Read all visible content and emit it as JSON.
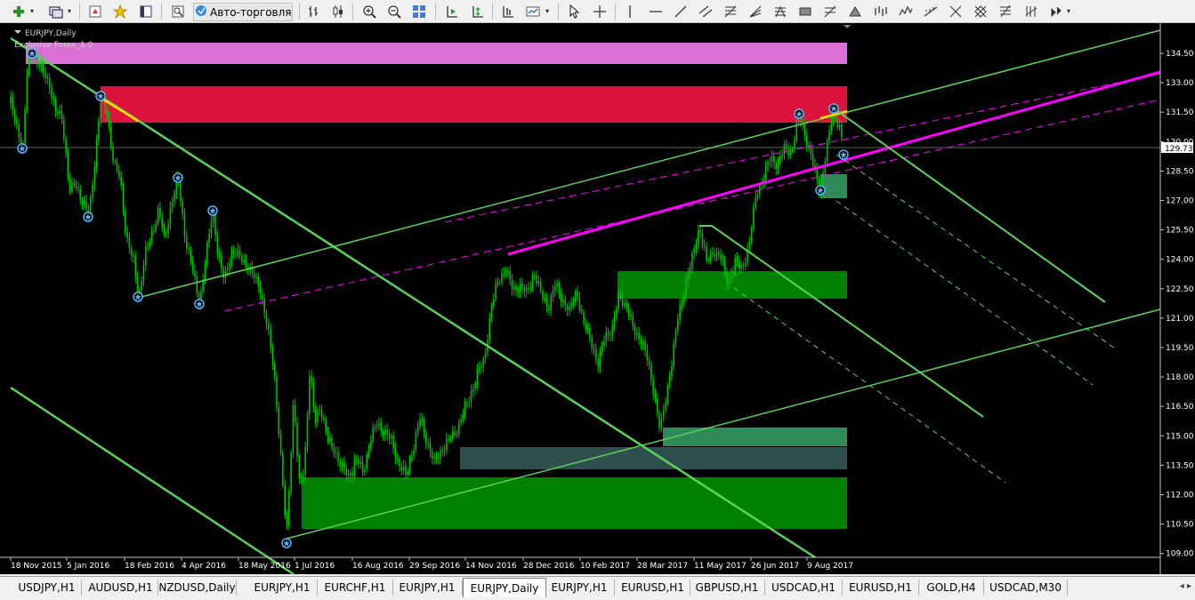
{
  "toolbar": {
    "auto_trading_label": "Авто-торговля",
    "icons": [
      "new-chart-icon",
      "profiles-icon",
      "market-watch-icon",
      "navigator-icon",
      "data-window-icon",
      "strategy-tester-icon",
      "auto-trading-icon",
      "bar-chart-icon",
      "candlestick-icon",
      "line-chart-icon",
      "zoom-in-icon",
      "zoom-out-icon",
      "tile-windows-icon",
      "autoscroll-icon",
      "chart-shift-icon",
      "periods-icon",
      "templates-icon",
      "cursor-icon",
      "crosshair-icon",
      "vertical-line-icon",
      "horizontal-line-icon",
      "trendline-icon",
      "equidistant-channel-icon",
      "fibo-retracement-icon",
      "fibo-fan-icon",
      "rectangle-icon",
      "text-icon",
      "triangle-icon",
      "andrews-pitchfork-icon",
      "gann-grid-icon",
      "fibo-levels-icon",
      "arrows-icon"
    ]
  },
  "chart": {
    "symbol_label": "EURJPY,Daily",
    "indicator_label": "Exclusive Forex_1.0",
    "current_price": "129.73",
    "price_axis": [
      "134.50",
      "133.00",
      "131.50",
      "130.00",
      "128.50",
      "127.00",
      "125.50",
      "124.00",
      "122.50",
      "121.00",
      "119.50",
      "118.00",
      "116.50",
      "115.00",
      "113.50",
      "112.00",
      "110.50",
      "109.00"
    ],
    "time_axis": [
      "18 Nov 2015",
      "5 Jan 2016",
      "18 Feb 2016",
      "4 Apr 2016",
      "18 May 2016",
      "1 Jul 2016",
      "16 Aug 2016",
      "29 Sep 2016",
      "14 Nov 2016",
      "28 Dec 2016",
      "10 Feb 2017",
      "28 Mar 2017",
      "11 May 2017",
      "26 Jun 2017",
      "9 Aug 2017"
    ],
    "colors": {
      "background": "#000000",
      "candles": "#00c000",
      "zone_violet": "#da70d6",
      "zone_crimson": "#dc143c",
      "zone_green": "#008000",
      "zone_teal": "#2e8b57",
      "zone_slate": "#2f4f4f",
      "trend": "#5ad35a",
      "magenta": "#ff00ff"
    }
  },
  "tabs": [
    {
      "label": "USDJPY,H1",
      "active": false
    },
    {
      "label": "AUDUSD,H1",
      "active": false
    },
    {
      "label": "NZDUSD,Daily",
      "active": false
    },
    {
      "label": "EURJPY,H1",
      "active": false
    },
    {
      "label": "EURCHF,H1",
      "active": false
    },
    {
      "label": "EURJPY,H1",
      "active": false
    },
    {
      "label": "EURJPY,Daily",
      "active": true
    },
    {
      "label": "EURJPY,H1",
      "active": false
    },
    {
      "label": "EURUSD,H1",
      "active": false
    },
    {
      "label": "GBPUSD,H1",
      "active": false
    },
    {
      "label": "USDCAD,H1",
      "active": false
    },
    {
      "label": "EURUSD,H1",
      "active": false
    },
    {
      "label": "GOLD,H4",
      "active": false
    },
    {
      "label": "USDCAD,M30",
      "active": false
    }
  ]
}
